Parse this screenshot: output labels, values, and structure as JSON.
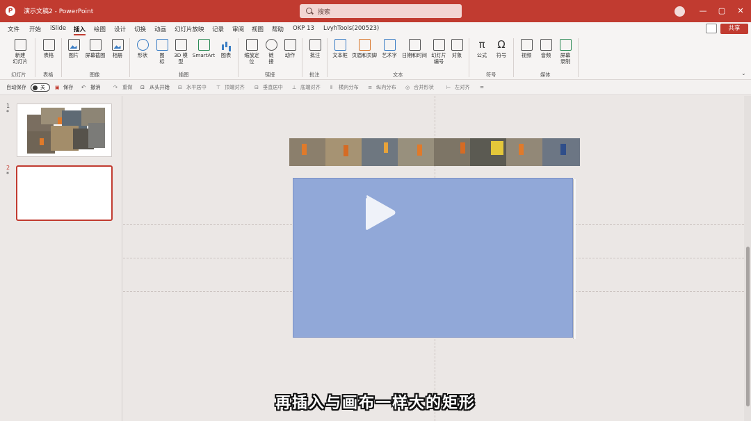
{
  "titlebar": {
    "doc_title": "演示文稿2 - PowerPoint",
    "search_placeholder": "搜索",
    "window_controls": [
      "—",
      "▢",
      "✕"
    ]
  },
  "menu": {
    "tabs": [
      "文件",
      "开始",
      "iSlide",
      "插入",
      "绘图",
      "设计",
      "切换",
      "动画",
      "幻灯片放映",
      "记录",
      "审阅",
      "视图",
      "帮助",
      "OKP 13",
      "LvyhTools(200523)"
    ],
    "active_tab": "插入",
    "share_label": "共享"
  },
  "ribbon": {
    "buttons": {
      "new_slide": "新建\n幻灯片",
      "table": "表格",
      "picture": "图片",
      "screenshot": "屏幕截图",
      "album": "相册",
      "shapes": "形状",
      "icons": "图\n标",
      "model3d": "3D 模\n型",
      "smartart": "SmartArt",
      "chart": "图表",
      "zoom": "缩放定\n位",
      "link": "链\n接",
      "action": "动作",
      "comment": "批注",
      "textbox": "文本框",
      "header_footer": "页眉和页脚",
      "wordart": "艺术字",
      "datetime": "日期和时间",
      "slide_number": "幻灯片\n编号",
      "object": "对象",
      "equation": "公式",
      "symbol": "符号",
      "video": "视频",
      "audio": "音频",
      "screen_record": "屏幕\n录制"
    },
    "groups": [
      "幻灯片",
      "表格",
      "图像",
      "插图",
      "链接",
      "批注",
      "文本",
      "符号",
      "媒体"
    ]
  },
  "qat": {
    "autosave_label": "自动保存",
    "toggle_state": "关",
    "items": [
      "保存",
      "撤消",
      "重做",
      "从头开始",
      "水平居中",
      "顶端对齐",
      "垂直居中",
      "底端对齐",
      "横向分布",
      "纵向分布",
      "合并形状",
      "左对齐"
    ]
  },
  "thumbnails": {
    "slide1_number": "1",
    "slide2_number": "2",
    "star": "*"
  },
  "subtitle": "再插入与画布一样大的矩形",
  "colors": {
    "accent": "#c13b30",
    "rectangle_fill": "#91a8d8"
  }
}
